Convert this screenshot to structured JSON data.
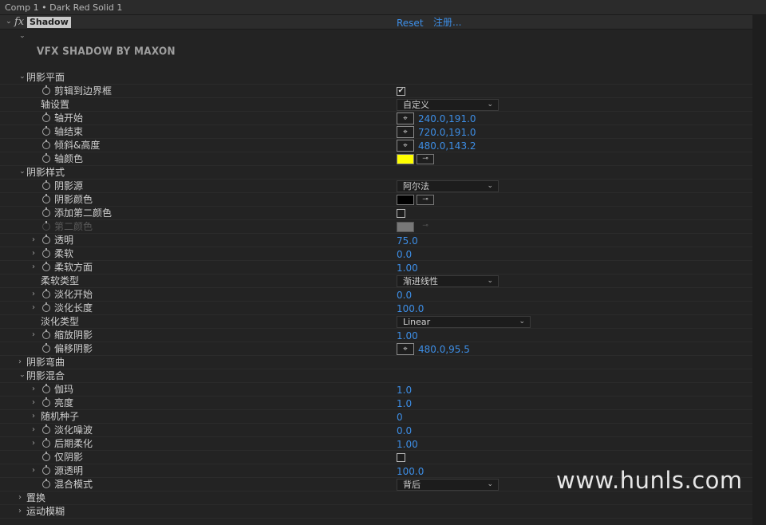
{
  "window": {
    "title": "Comp 1 • Dark Red Solid 1"
  },
  "effect": {
    "fx_glyph": "fx",
    "name": "Shadow",
    "reset_label": "Reset",
    "register_label": "注册...",
    "logo_text": "VFX SHADOW BY MAXON"
  },
  "sections": {
    "plane": {
      "title": "阴影平面",
      "clip": {
        "label": "剪辑到边界框",
        "checked_glyph": "✔"
      },
      "axis_setting": {
        "label": "轴设置",
        "value": "自定义"
      },
      "axis_start": {
        "label": "轴开始",
        "value": "240.0,191.0"
      },
      "axis_end": {
        "label": "轴结束",
        "value": "720.0,191.0"
      },
      "tilt_height": {
        "label": "倾斜&高度",
        "value": "480.0,143.2"
      },
      "axis_color": {
        "label": "轴颜色",
        "color": "#ffff00"
      }
    },
    "style": {
      "title": "阴影样式",
      "source": {
        "label": "阴影源",
        "value": "阿尔法"
      },
      "shadow_color": {
        "label": "阴影颜色",
        "color": "#000000"
      },
      "add_second": {
        "label": "添加第二颜色"
      },
      "second_color": {
        "label": "第二颜色",
        "color": "#777777"
      },
      "opacity": {
        "label": "透明",
        "value": "75.0"
      },
      "softness": {
        "label": "柔软",
        "value": "0.0"
      },
      "soft_aspect": {
        "label": "柔软方面",
        "value": "1.00"
      },
      "soft_type": {
        "label": "柔软类型",
        "value": "渐进线性"
      },
      "fade_start": {
        "label": "淡化开始",
        "value": "0.0"
      },
      "fade_length": {
        "label": "淡化长度",
        "value": "100.0"
      },
      "fade_type": {
        "label": "淡化类型",
        "value": "Linear"
      },
      "scale": {
        "label": "缩放阴影",
        "value": "1.00"
      },
      "offset": {
        "label": "偏移阴影",
        "value": "480.0,95.5"
      }
    },
    "bend": {
      "title": "阴影弯曲"
    },
    "blend": {
      "title": "阴影混合",
      "gamma": {
        "label": "伽玛",
        "value": "1.0"
      },
      "brightness": {
        "label": "亮度",
        "value": "1.0"
      },
      "seed": {
        "label": "随机种子",
        "value": "0"
      },
      "fade_noise": {
        "label": "淡化噪波",
        "value": "0.0"
      },
      "post_soften": {
        "label": "后期柔化",
        "value": "1.00"
      },
      "shadow_only": {
        "label": "仅阴影"
      },
      "source_opacity": {
        "label": "源透明",
        "value": "100.0"
      },
      "blend_mode": {
        "label": "混合模式",
        "value": "背后"
      }
    },
    "displace": {
      "title": "置换"
    },
    "motion_blur": {
      "title": "运动模糊"
    }
  },
  "icons": {
    "chevron": "›",
    "dropdown_arrow": "⌄",
    "point_target": "⌖",
    "eyedropper": "⊸"
  },
  "watermark": "www.hunls.com"
}
